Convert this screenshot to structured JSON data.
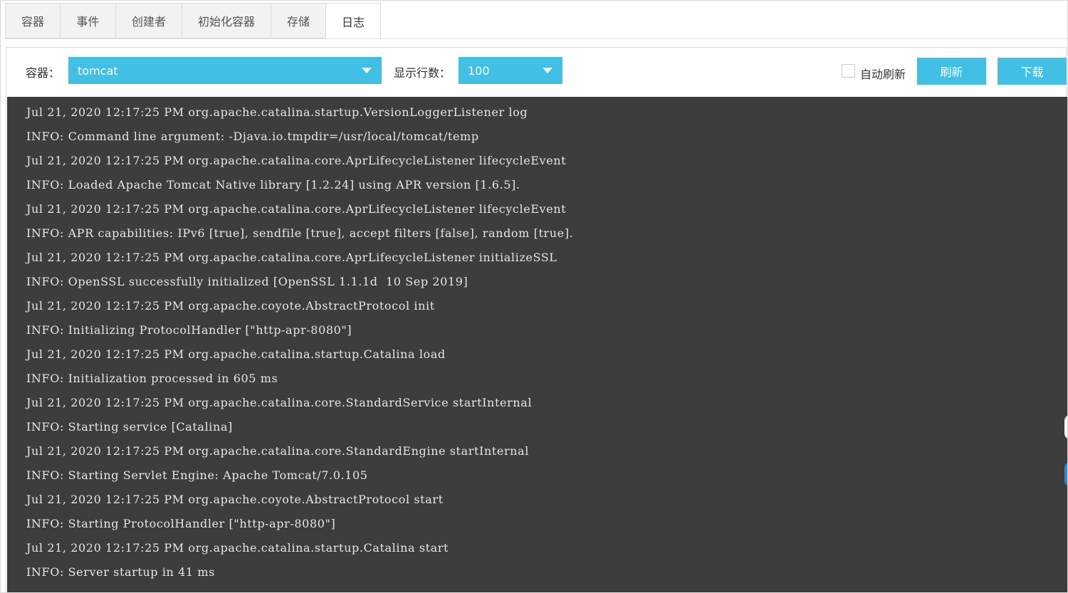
{
  "tabs": [
    {
      "label": "容器",
      "active": false
    },
    {
      "label": "事件",
      "active": false
    },
    {
      "label": "创建者",
      "active": false
    },
    {
      "label": "初始化容器",
      "active": false
    },
    {
      "label": "存储",
      "active": false
    },
    {
      "label": "日志",
      "active": true
    }
  ],
  "toolbar": {
    "container_label": "容器：",
    "container_value": "tomcat",
    "lines_label": "显示行数：",
    "lines_value": "100",
    "auto_refresh_label": "自动刷新",
    "auto_refresh_checked": false,
    "refresh_button": "刷新",
    "download_button": "下载"
  },
  "colors": {
    "accent": "#42bfe4",
    "log_background": "#3d3d3d",
    "log_text": "#e6e6e6"
  },
  "log_lines": [
    "Jul 21, 2020 12:17:25 PM org.apache.catalina.startup.VersionLoggerListener log",
    "INFO: Command line argument: -Djava.io.tmpdir=/usr/local/tomcat/temp",
    "Jul 21, 2020 12:17:25 PM org.apache.catalina.core.AprLifecycleListener lifecycleEvent",
    "INFO: Loaded Apache Tomcat Native library [1.2.24] using APR version [1.6.5].",
    "Jul 21, 2020 12:17:25 PM org.apache.catalina.core.AprLifecycleListener lifecycleEvent",
    "INFO: APR capabilities: IPv6 [true], sendfile [true], accept filters [false], random [true].",
    "Jul 21, 2020 12:17:25 PM org.apache.catalina.core.AprLifecycleListener initializeSSL",
    "INFO: OpenSSL successfully initialized [OpenSSL 1.1.1d  10 Sep 2019]",
    "Jul 21, 2020 12:17:25 PM org.apache.coyote.AbstractProtocol init",
    "INFO: Initializing ProtocolHandler [\"http-apr-8080\"]",
    "Jul 21, 2020 12:17:25 PM org.apache.catalina.startup.Catalina load",
    "INFO: Initialization processed in 605 ms",
    "Jul 21, 2020 12:17:25 PM org.apache.catalina.core.StandardService startInternal",
    "INFO: Starting service [Catalina]",
    "Jul 21, 2020 12:17:25 PM org.apache.catalina.core.StandardEngine startInternal",
    "INFO: Starting Servlet Engine: Apache Tomcat/7.0.105",
    "Jul 21, 2020 12:17:25 PM org.apache.coyote.AbstractProtocol start",
    "INFO: Starting ProtocolHandler [\"http-apr-8080\"]",
    "Jul 21, 2020 12:17:25 PM org.apache.catalina.startup.Catalina start",
    "INFO: Server startup in 41 ms"
  ]
}
